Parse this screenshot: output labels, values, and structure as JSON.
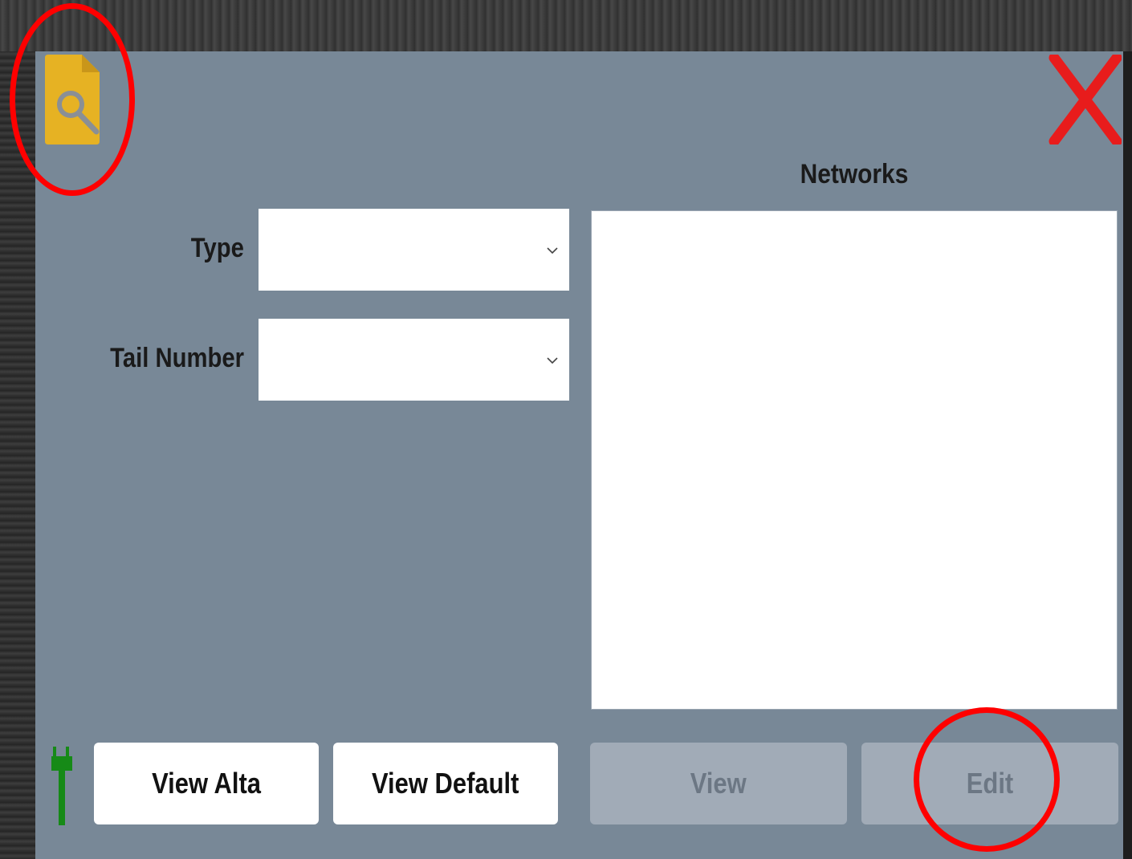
{
  "form": {
    "type_label": "Type",
    "type_value": "",
    "tail_label": "Tail Number",
    "tail_value": ""
  },
  "networks": {
    "title": "Networks",
    "items": []
  },
  "buttons": {
    "view_alta": "View Alta",
    "view_default": "View Default",
    "view": "View",
    "edit": "Edit"
  },
  "icons": {
    "app": "document-search-icon",
    "close": "close-icon",
    "connection": "plug-icon"
  },
  "colors": {
    "panel": "#788897",
    "app_icon": "#e6b223",
    "close": "#e81c1c",
    "connection": "#168a17",
    "disabled_button": "#a1abb7",
    "annotation": "#ff0000"
  }
}
